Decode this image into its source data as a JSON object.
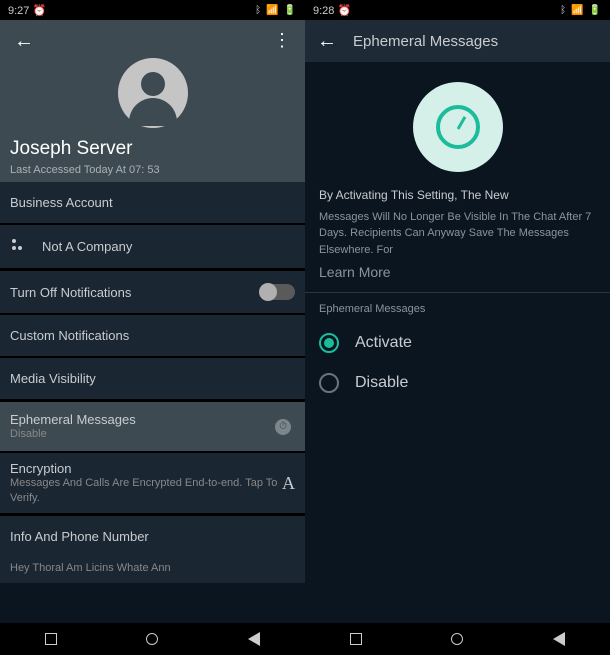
{
  "left": {
    "status_time": "9:27",
    "status_alarm": "⏰",
    "profile_name": "Joseph Server",
    "last_accessed": "Last Accessed Today At 07: 53",
    "business_account": "Business Account",
    "not_company": "Not A Company",
    "turn_off_notif": "Turn Off Notifications",
    "custom_notif": "Custom Notifications",
    "media_visibility": "Media Visibility",
    "ephemeral_title": "Ephemeral Messages",
    "ephemeral_sub": "Disable",
    "encryption_title": "Encryption",
    "encryption_sub": "Messages And Calls Are Encrypted End-to-end. Tap To Verify.",
    "encryption_badge": "A",
    "info_phone": "Info And Phone Number",
    "bottom_text": "Hey Thoral Am Licins Whate Ann"
  },
  "right": {
    "status_time": "9:28",
    "status_alarm": "⏰",
    "header_title": "Ephemeral Messages",
    "desc_line1": "By Activating This Setting, The New",
    "desc_rest": "Messages Will No Longer Be Visible In The Chat After 7 Days. Recipients Can Anyway Save The Messages Elsewhere. For",
    "learn_more": "Learn More",
    "radio_section_label": "Ephemeral Messages",
    "opt_activate": "Activate",
    "opt_disable": "Disable"
  }
}
